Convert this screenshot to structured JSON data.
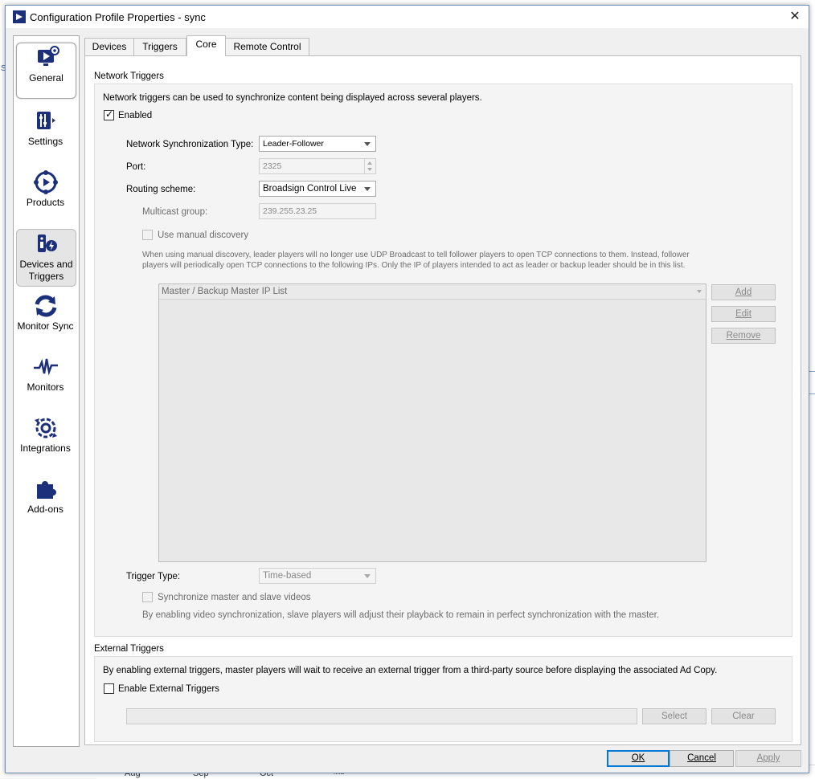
{
  "window": {
    "title": "Configuration Profile Properties - sync",
    "close_glyph": "✕"
  },
  "nav": [
    {
      "label": "General",
      "icon": "monitor-play-gear-icon"
    },
    {
      "label": "Settings",
      "icon": "settings-sliders-icon"
    },
    {
      "label": "Products",
      "icon": "products-play-icon"
    },
    {
      "label": "Devices and Triggers",
      "icon": "devices-triggers-icon"
    },
    {
      "label": "Monitor Sync",
      "icon": "monitor-sync-icon"
    },
    {
      "label": "Monitors",
      "icon": "monitors-pulse-icon"
    },
    {
      "label": "Integrations",
      "icon": "integrations-gear-icon"
    },
    {
      "label": "Add-ons",
      "icon": "addons-puzzle-icon"
    }
  ],
  "tabs": [
    "Devices",
    "Triggers",
    "Core",
    "Remote Control"
  ],
  "active_tab": "Core",
  "network": {
    "group_title": "Network Triggers",
    "description": "Network triggers can be used to synchronize content being displayed across several players.",
    "enabled_label": "Enabled",
    "enabled": true,
    "sync_type_label": "Network Synchronization Type:",
    "sync_type_value": "Leader-Follower",
    "port_label": "Port:",
    "port_value": "2325",
    "routing_label": "Routing scheme:",
    "routing_value": "Broadsign Control Live",
    "multicast_label": "Multicast group:",
    "multicast_value": "239.255.23.25",
    "manual_discovery_label": "Use manual discovery",
    "manual_note": "When using manual discovery, leader players will no longer use UDP Broadcast to tell follower players to open TCP connections to them. Instead, follower players will periodically open TCP connections to the following IPs. Only the IP of players intended to act as leader or backup leader should be in this list.",
    "list_header": "Master / Backup Master IP List",
    "buttons": {
      "add": "Add",
      "edit": "Edit",
      "remove": "Remove"
    },
    "trigger_type_label": "Trigger Type:",
    "trigger_type_value": "Time-based",
    "sync_videos_label": "Synchronize master and slave videos",
    "sync_videos_note": "By enabling video synchronization, slave players will adjust their playback to remain in perfect synchronization with the master."
  },
  "external": {
    "group_title": "External Triggers",
    "description": "By enabling external triggers, master players will wait to receive an external trigger from a third-party source before displaying the associated Ad Copy.",
    "enable_label": "Enable External Triggers",
    "enabled": false,
    "path_value": "",
    "select_label": "Select",
    "clear_label": "Clear"
  },
  "footer": {
    "ok": "OK",
    "cancel": "Cancel",
    "apply": "Apply"
  },
  "background": {
    "months": [
      "Aug",
      "Sep",
      "Oct"
    ],
    "side_letter": "S",
    "tag": "Mia"
  }
}
